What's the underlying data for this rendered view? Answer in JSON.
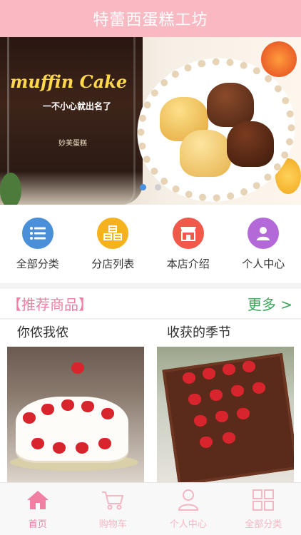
{
  "header": {
    "title": "特蕾西蛋糕工坊"
  },
  "banner": {
    "brand": "muffin Cake",
    "slogan": "一不小心就出名了",
    "sub": "妙芙蛋糕",
    "page_dots": 2,
    "active_dot": 1
  },
  "categories": [
    {
      "label": "全部分类",
      "icon": "list-icon",
      "color": "#4a8fd8"
    },
    {
      "label": "分店列表",
      "icon": "store-list-icon",
      "color": "#f6b21c"
    },
    {
      "label": "本店介绍",
      "icon": "storefront-icon",
      "color": "#f0594a"
    },
    {
      "label": "个人中心",
      "icon": "person-icon",
      "color": "#b36ad8"
    }
  ],
  "recommend": {
    "title": "【推荐商品】",
    "more": "更多 >"
  },
  "products": [
    {
      "name": "你侬我侬"
    },
    {
      "name": "收获的季节"
    }
  ],
  "tabbar": {
    "items": [
      {
        "label": "首页",
        "icon": "home-icon",
        "active": true
      },
      {
        "label": "购物车",
        "icon": "cart-icon",
        "active": false
      },
      {
        "label": "个人中心",
        "icon": "user-icon",
        "active": false
      },
      {
        "label": "全部分类",
        "icon": "grid-icon",
        "active": false
      }
    ]
  },
  "colors": {
    "header_bg": "#f8b9c3",
    "accent_pink": "#f07fa2",
    "more_green": "#3aa65a",
    "tab_inactive": "#f4b6c4"
  }
}
